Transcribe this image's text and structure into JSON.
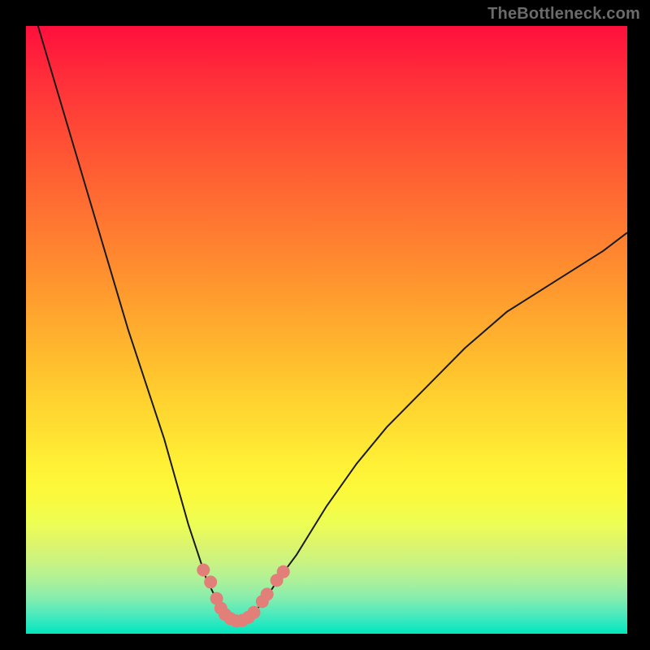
{
  "watermark": "TheBottleneck.com",
  "colors": {
    "frame_bg": "#000000",
    "curve_stroke": "#1a1a1a",
    "marker_fill": "#e27f79",
    "gradient_top": "#ff0f3c",
    "gradient_bottom": "#01e6bf"
  },
  "chart_data": {
    "type": "line",
    "title": "",
    "xlabel": "",
    "ylabel": "",
    "xlim": [
      0,
      100
    ],
    "ylim": [
      0,
      100
    ],
    "series": [
      {
        "name": "bottleneck-curve",
        "x": [
          2,
          5,
          8,
          11,
          14,
          17,
          20,
          23,
          25,
          27,
          29,
          30,
          31,
          32,
          33,
          34,
          35,
          36,
          37,
          38,
          40,
          42,
          45,
          50,
          55,
          60,
          66,
          73,
          80,
          88,
          96,
          100
        ],
        "values": [
          100,
          90,
          80,
          70,
          60,
          50,
          41,
          32,
          25,
          18,
          12,
          9,
          7,
          5,
          3.5,
          2.5,
          2,
          2.1,
          2.6,
          3.5,
          6,
          9,
          13,
          21,
          28,
          34,
          40,
          47,
          53,
          58,
          63,
          66
        ]
      }
    ],
    "markers": [
      {
        "x": 29.5,
        "y": 10.5
      },
      {
        "x": 30.7,
        "y": 8.5
      },
      {
        "x": 31.7,
        "y": 5.8
      },
      {
        "x": 32.4,
        "y": 4.2
      },
      {
        "x": 33.1,
        "y": 3.2
      },
      {
        "x": 34.0,
        "y": 2.5
      },
      {
        "x": 35.0,
        "y": 2.1
      },
      {
        "x": 36.0,
        "y": 2.2
      },
      {
        "x": 37.0,
        "y": 2.7
      },
      {
        "x": 37.9,
        "y": 3.5
      },
      {
        "x": 39.3,
        "y": 5.3
      },
      {
        "x": 40.1,
        "y": 6.5
      },
      {
        "x": 41.7,
        "y": 8.8
      },
      {
        "x": 42.8,
        "y": 10.2
      }
    ],
    "marker_radius_px": 8,
    "grid": false,
    "legend": false
  }
}
